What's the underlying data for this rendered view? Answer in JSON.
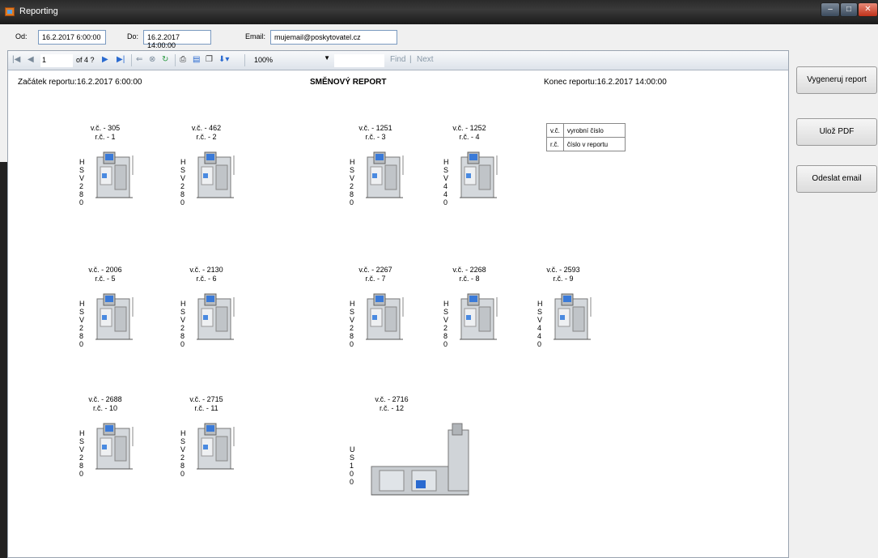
{
  "window": {
    "title": "Reporting"
  },
  "filters": {
    "from_label": "Od:",
    "from_value": "16.2.2017 6:00:00",
    "to_label": "Do:",
    "to_value": "16.2.2017 14:00:00",
    "email_label": "Email:",
    "email_value": "mujemail@poskytovatel.cz"
  },
  "toolbar": {
    "page": "1",
    "of_pages": "of 4 ?",
    "zoom": "100%",
    "find": "Find",
    "separator": "|",
    "next": "Next"
  },
  "report": {
    "start": "Začátek reportu:16.2.2017 6:00:00",
    "title": "SMĚNOVÝ REPORT",
    "end": "Konec reportu:16.2.2017 14:00:00",
    "legend": [
      {
        "abbr": "v.č.",
        "desc": "vyrobní číslo"
      },
      {
        "abbr": "r.č.",
        "desc": "číslo v reportu"
      }
    ],
    "machines": [
      {
        "vc": "v.č. - 305",
        "rc": "r.č. - 1",
        "type": [
          "H",
          "S",
          "V",
          "2",
          "8",
          "0"
        ]
      },
      {
        "vc": "v.č. - 462",
        "rc": "r.č. - 2",
        "type": [
          "H",
          "S",
          "V",
          "2",
          "8",
          "0"
        ]
      },
      {
        "vc": "v.č. - 1251",
        "rc": "r.č. - 3",
        "type": [
          "H",
          "S",
          "V",
          "2",
          "8",
          "0"
        ]
      },
      {
        "vc": "v.č. - 1252",
        "rc": "r.č. - 4",
        "type": [
          "H",
          "S",
          "V",
          "4",
          "4",
          "0"
        ]
      },
      {
        "vc": "v.č. - 2006",
        "rc": "r.č. - 5",
        "type": [
          "H",
          "S",
          "V",
          "2",
          "8",
          "0"
        ]
      },
      {
        "vc": "v.č. - 2130",
        "rc": "r.č. - 6",
        "type": [
          "H",
          "S",
          "V",
          "2",
          "8",
          "0"
        ]
      },
      {
        "vc": "v.č. - 2267",
        "rc": "r.č. - 7",
        "type": [
          "H",
          "S",
          "V",
          "2",
          "8",
          "0"
        ]
      },
      {
        "vc": "v.č. - 2268",
        "rc": "r.č. - 8",
        "type": [
          "H",
          "S",
          "V",
          "2",
          "8",
          "0"
        ]
      },
      {
        "vc": "v.č. - 2593",
        "rc": "r.č. - 9",
        "type": [
          "H",
          "S",
          "V",
          "4",
          "4",
          "0"
        ]
      },
      {
        "vc": "v.č. - 2688",
        "rc": "r.č. - 10",
        "type": [
          "H",
          "S",
          "V",
          "2",
          "8",
          "0"
        ]
      },
      {
        "vc": "v.č. - 2715",
        "rc": "r.č. - 11",
        "type": [
          "H",
          "S",
          "V",
          "2",
          "8",
          "0"
        ]
      },
      {
        "vc": "v.č. - 2716",
        "rc": "r.č. - 12",
        "type": [
          "U",
          "S",
          "1",
          "0",
          "0"
        ]
      }
    ]
  },
  "actions": {
    "generate": "Vygeneruj report",
    "save_pdf": "Ulož PDF",
    "send_email": "Odeslat email"
  }
}
